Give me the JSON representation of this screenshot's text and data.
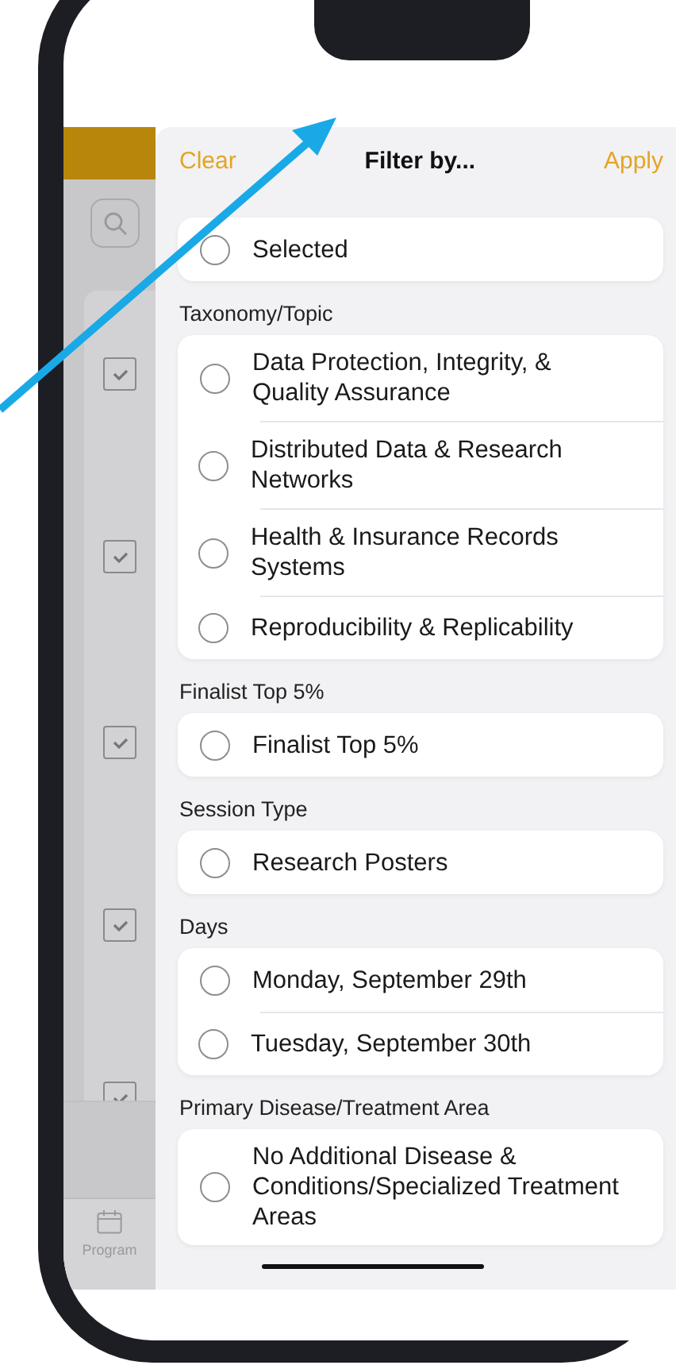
{
  "background_screen": {
    "checkboxes": [
      {
        "checked": true
      },
      {
        "checked": true
      },
      {
        "checked": true
      },
      {
        "checked": true
      },
      {
        "checked": true
      }
    ],
    "tab_bar": {
      "items": [
        {
          "label": "Program",
          "selected": false
        }
      ]
    }
  },
  "filter_sheet": {
    "clear": "Clear",
    "title": "Filter by...",
    "apply": "Apply",
    "sections": [
      {
        "options": [
          {
            "label": "Selected",
            "selected": false
          }
        ]
      },
      {
        "heading": "Taxonomy/Topic",
        "options": [
          {
            "label": "Data Protection, Integrity, & Quality Assurance",
            "selected": false
          },
          {
            "label": "Distributed Data & Research Networks",
            "selected": false
          },
          {
            "label": "Health & Insurance Records Systems",
            "selected": false
          },
          {
            "label": "Reproducibility & Replicability",
            "selected": false
          }
        ]
      },
      {
        "heading": "Finalist Top 5%",
        "options": [
          {
            "label": "Finalist Top 5%",
            "selected": false
          }
        ]
      },
      {
        "heading": "Session Type",
        "options": [
          {
            "label": "Research Posters",
            "selected": false
          }
        ]
      },
      {
        "heading": "Days",
        "options": [
          {
            "label": "Monday, September 29th",
            "selected": false
          },
          {
            "label": "Tuesday, September 30th",
            "selected": false
          }
        ]
      },
      {
        "heading": "Primary Disease/Treatment Area",
        "options": [
          {
            "label": "No Additional Disease & Conditions/Specialized Treatment Areas",
            "selected": false
          }
        ]
      }
    ]
  }
}
